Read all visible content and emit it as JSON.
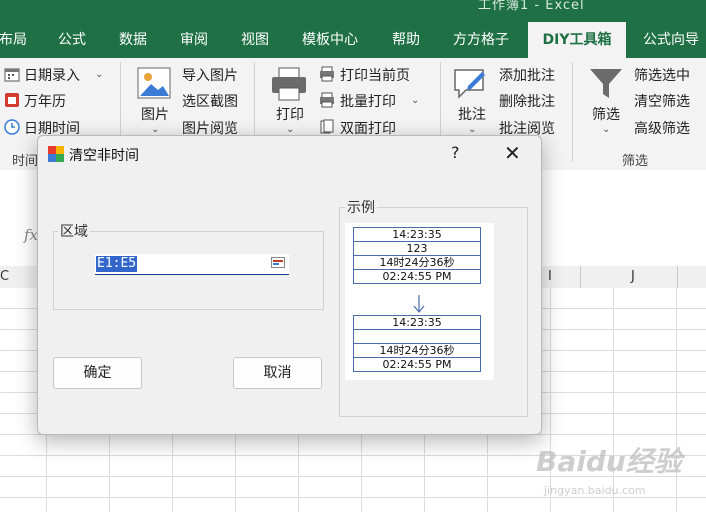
{
  "window": {
    "title": "工作簿1 - Excel"
  },
  "tabs": [
    {
      "label": "布局"
    },
    {
      "label": "公式"
    },
    {
      "label": "数据"
    },
    {
      "label": "审阅"
    },
    {
      "label": "视图"
    },
    {
      "label": "模板中心"
    },
    {
      "label": "帮助"
    },
    {
      "label": "方方格子"
    },
    {
      "label": "DIY工具箱",
      "active": true
    },
    {
      "label": "公式向导"
    }
  ],
  "ribbon": {
    "date_group": {
      "items": [
        "日期录入",
        "万年历",
        "日期时间"
      ],
      "label": "时间"
    },
    "image_group": {
      "main": "图片",
      "items": [
        "导入图片",
        "选区截图",
        "图片阅览"
      ]
    },
    "print_group": {
      "main": "打印",
      "items": [
        "打印当前页",
        "批量打印",
        "双面打印"
      ]
    },
    "comment_group": {
      "main": "批注",
      "items": [
        "添加批注",
        "删除批注",
        "批注阅览"
      ]
    },
    "filter_group": {
      "main": "筛选",
      "items": [
        "筛选选中",
        "清空筛选",
        "高级筛选"
      ],
      "label": "筛选"
    }
  },
  "sheet": {
    "fx_label": "fx",
    "columns": [
      "C",
      "I",
      "J"
    ]
  },
  "dialog": {
    "title": "清空非时间",
    "help": "?",
    "close": "✕",
    "area_legend": "区域",
    "range_value": "E1:E5",
    "example_legend": "示例",
    "ok_label": "确定",
    "cancel_label": "取消",
    "example_before": [
      "14:23:35",
      "123",
      "14时24分36秒",
      "02:24:55 PM"
    ],
    "example_after": [
      "14:23:35",
      "",
      "14时24分36秒",
      "02:24:55 PM"
    ]
  },
  "watermark": {
    "brand": "Baidu经验",
    "url": "jingyan.baidu.com"
  },
  "colors": {
    "excel_green": "#1f7145",
    "accent_blue": "#3366cc",
    "ribbon_bg": "#f3f3f3"
  }
}
